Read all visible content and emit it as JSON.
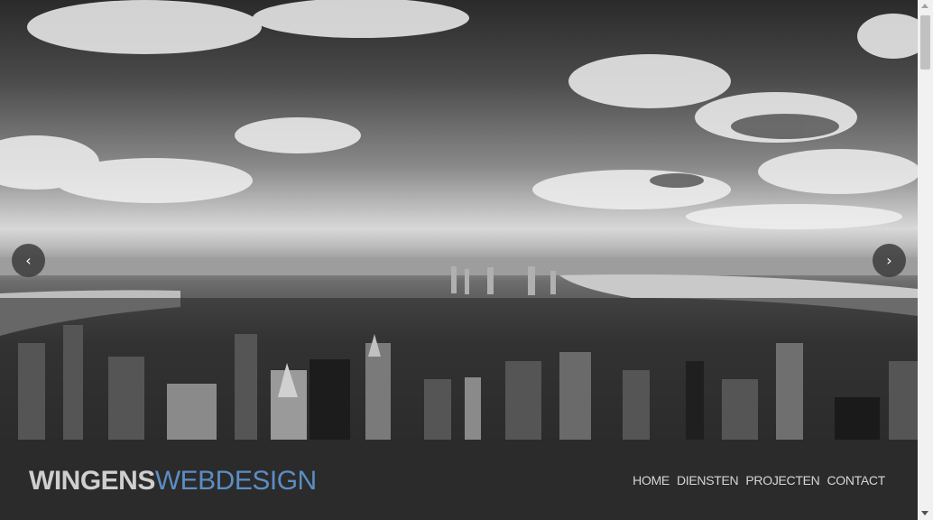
{
  "hero": {
    "image": "black-and-white aerial city skyline",
    "prev_icon": "chevron-left-icon",
    "next_icon": "chevron-right-icon",
    "prev_glyph": "‹",
    "next_glyph": "›"
  },
  "header": {
    "logo_bold": "WINGENS",
    "logo_light": "WEBDESIGN",
    "nav": [
      {
        "label": "HOME"
      },
      {
        "label": "DIENSTEN"
      },
      {
        "label": "PROJECTEN"
      },
      {
        "label": "CONTACT"
      }
    ]
  },
  "colors": {
    "header_bg": "#2b2b2b",
    "logo_accent": "#5b8ec4",
    "nav_text": "#d6d6d6"
  }
}
